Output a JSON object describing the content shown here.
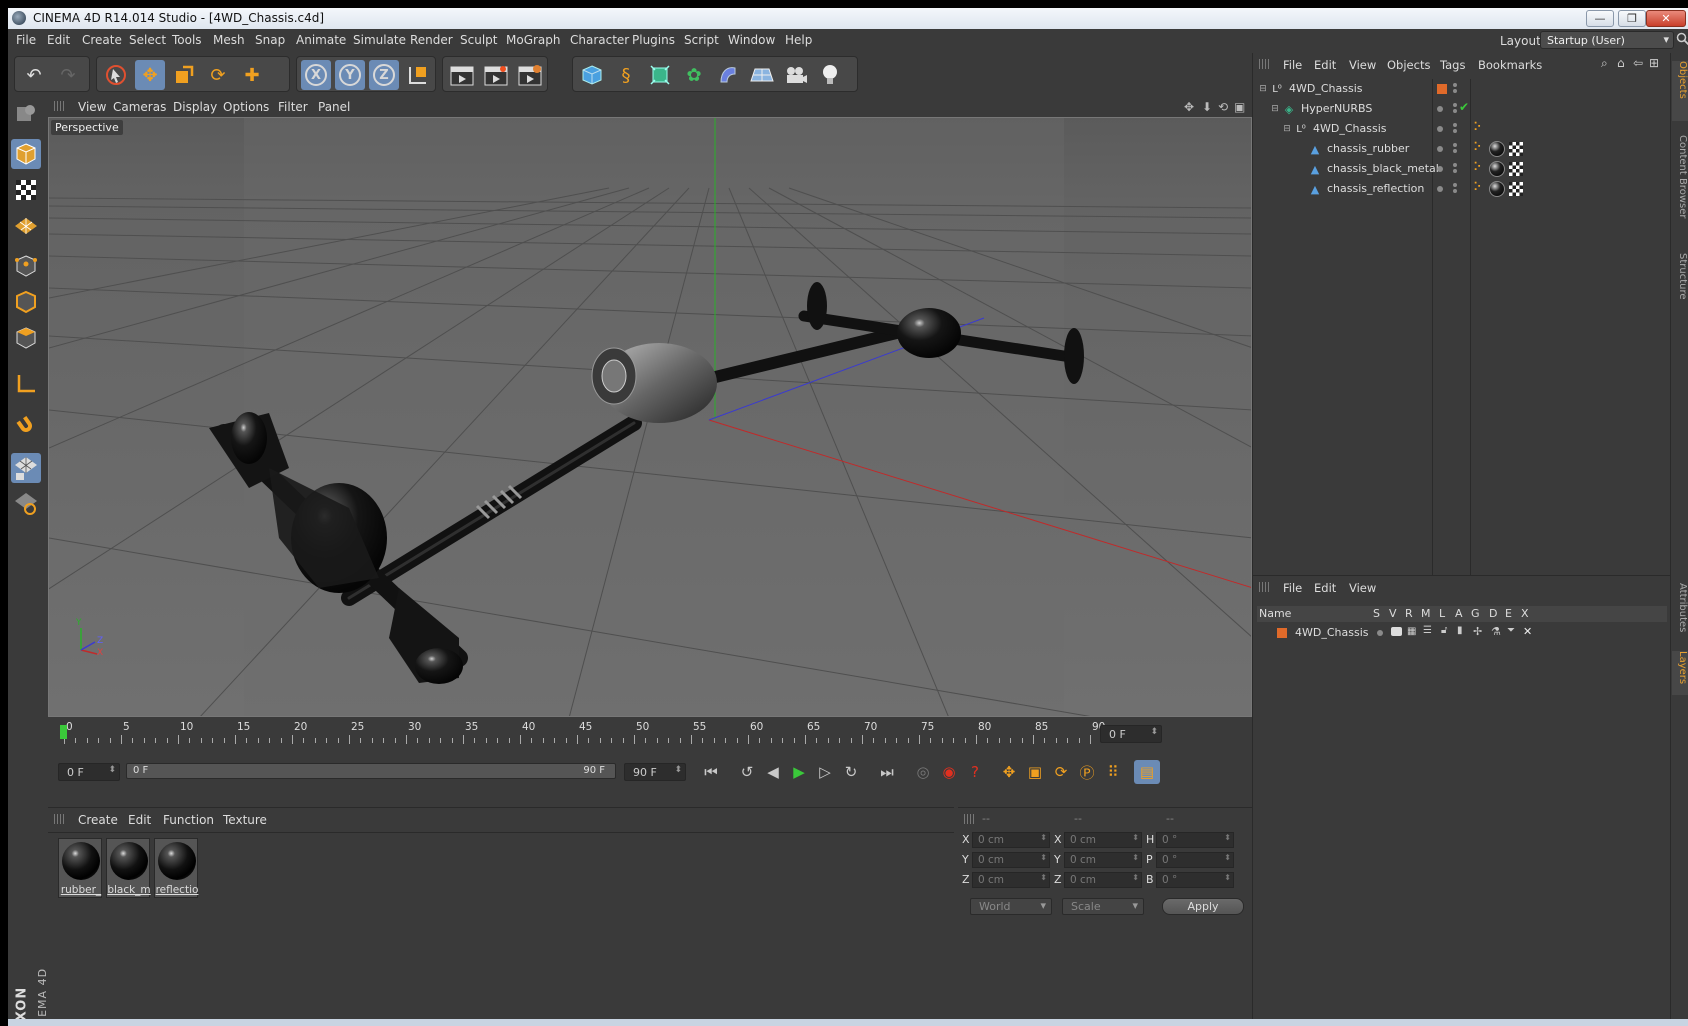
{
  "window": {
    "title": "CINEMA 4D R14.014 Studio - [4WD_Chassis.c4d]",
    "minimize": "—",
    "restore": "❐",
    "close": "✕"
  },
  "menubar": {
    "items": [
      "File",
      "Edit",
      "Create",
      "Select",
      "Tools",
      "Mesh",
      "Snap",
      "Animate",
      "Simulate",
      "Render",
      "Sculpt",
      "MoGraph",
      "Character",
      "Plugins",
      "Script",
      "Window",
      "Help"
    ],
    "layout_label": "Layout:",
    "layout_value": "Startup (User)"
  },
  "viewport": {
    "menu": [
      "View",
      "Cameras",
      "Display",
      "Options",
      "Filter",
      "Panel"
    ],
    "label": "Perspective",
    "axis_y": "Y",
    "axis_z": "Z",
    "axis_x": "X"
  },
  "timeline": {
    "ticks": [
      "0",
      "5",
      "10",
      "15",
      "20",
      "25",
      "30",
      "35",
      "40",
      "45",
      "50",
      "55",
      "60",
      "65",
      "70",
      "75",
      "80",
      "85",
      "90"
    ],
    "current_frame": "0 F",
    "start_field": "0 F",
    "range_start": "0 F",
    "range_end": "90 F",
    "end_field": "90 F"
  },
  "material_manager": {
    "menu": [
      "Create",
      "Edit",
      "Function",
      "Texture"
    ],
    "materials": [
      "rubber_",
      "black_m",
      "reflectio"
    ]
  },
  "coordinates": {
    "headers": [
      "--",
      "--",
      "--"
    ],
    "rows": [
      {
        "l1": "X",
        "v1": "0 cm",
        "l2": "X",
        "v2": "0 cm",
        "l3": "H",
        "v3": "0 °"
      },
      {
        "l1": "Y",
        "v1": "0 cm",
        "l2": "Y",
        "v2": "0 cm",
        "l3": "P",
        "v3": "0 °"
      },
      {
        "l1": "Z",
        "v1": "0 cm",
        "l2": "Z",
        "v2": "0 cm",
        "l3": "B",
        "v3": "0 °"
      }
    ],
    "mode": "World",
    "scale": "Scale",
    "apply": "Apply"
  },
  "object_manager": {
    "menu": [
      "File",
      "Edit",
      "View",
      "Objects",
      "Tags",
      "Bookmarks"
    ],
    "objects": [
      {
        "name": "4WD_Chassis",
        "type": "null"
      },
      {
        "name": "HyperNURBS",
        "type": "hypernurbs"
      },
      {
        "name": "4WD_Chassis",
        "type": "null"
      },
      {
        "name": "chassis_rubber",
        "type": "polygon"
      },
      {
        "name": "chassis_black_metal",
        "type": "polygon"
      },
      {
        "name": "chassis_reflection",
        "type": "polygon"
      }
    ]
  },
  "layer_manager": {
    "menu": [
      "File",
      "Edit",
      "View"
    ],
    "columns": [
      "Name",
      "S",
      "V",
      "R",
      "M",
      "L",
      "A",
      "G",
      "D",
      "E",
      "X"
    ],
    "layers": [
      {
        "name": "4WD_Chassis",
        "color": "#e06a2a"
      }
    ]
  },
  "right_tabs": [
    "Objects",
    "Content Browser",
    "Structure",
    "Attributes",
    "Layers"
  ],
  "colors": {
    "accent_active": "#6b8bb5",
    "icon_orange": "#f0a020",
    "layer_color": "#e06a2a",
    "grid_axis_x": "#c02a2a",
    "grid_axis_y": "#2ab02a",
    "grid_axis_z": "#3a3ad0"
  }
}
